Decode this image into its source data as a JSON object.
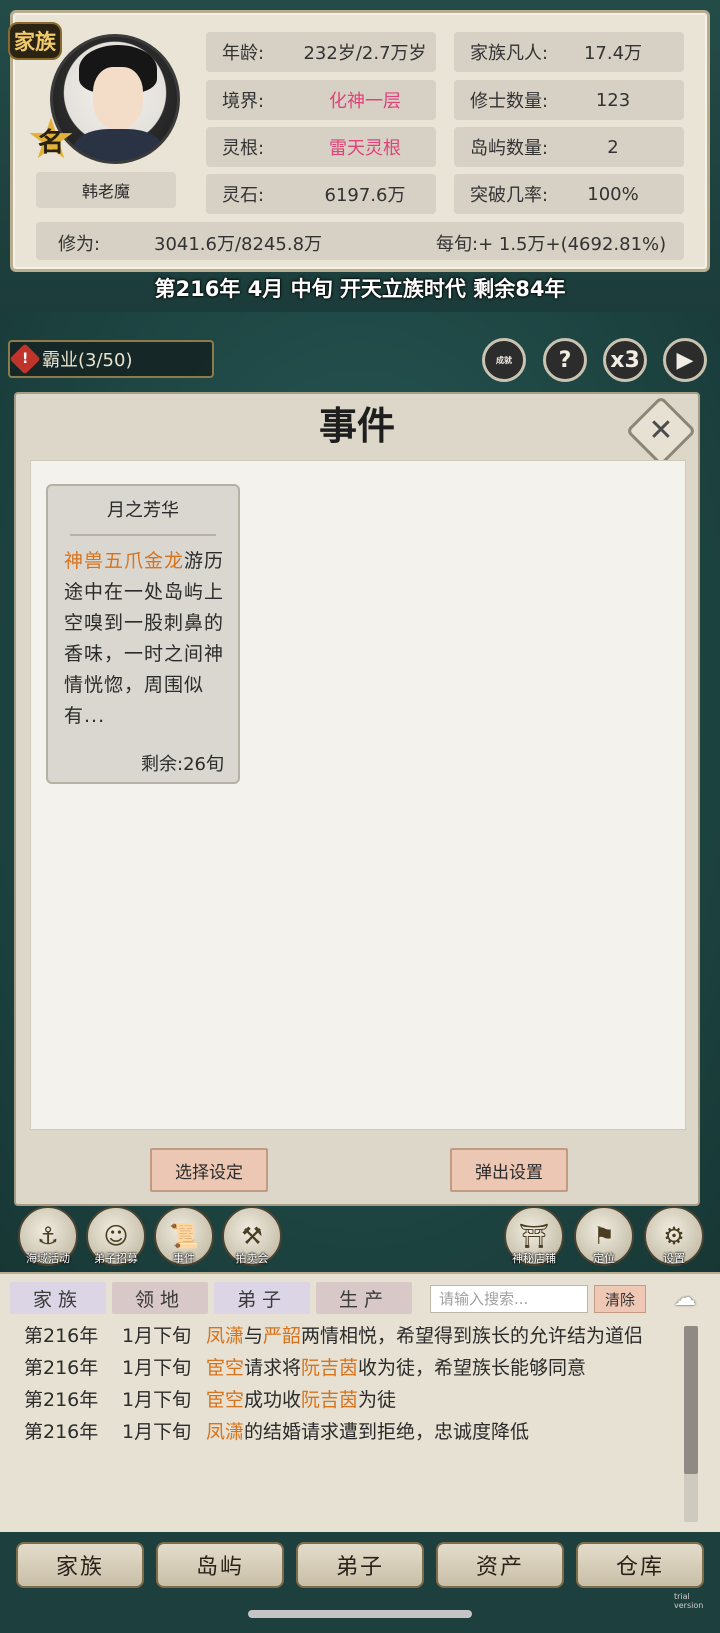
{
  "header": {
    "clan_badge": "家族",
    "star_label": "名",
    "hero_name": "韩老魔",
    "stats": [
      {
        "label": "年龄:",
        "value": "232岁/2.7万岁",
        "highlight": false
      },
      {
        "label": "家族凡人:",
        "value": "17.4万",
        "highlight": false
      },
      {
        "label": "境界:",
        "value": "化神一层",
        "highlight": true
      },
      {
        "label": "修士数量:",
        "value": "123",
        "highlight": false
      },
      {
        "label": "灵根:",
        "value": "雷天灵根",
        "highlight": true
      },
      {
        "label": "岛屿数量:",
        "value": "2",
        "highlight": false
      },
      {
        "label": "灵石:",
        "value": "6197.6万",
        "highlight": false
      },
      {
        "label": "突破几率:",
        "value": "100%",
        "highlight": false
      }
    ],
    "xiuwei_label": "修为:",
    "xiuwei_value": "3041.6万/8245.8万",
    "per_xun": "每旬:+ 1.5万+(4692.81%)",
    "time_line": "第216年 4月  中旬  开天立族时代 剩余84年"
  },
  "toolbar": {
    "hegemony": "霸业(3/50)",
    "achievement": "成就",
    "help": "?",
    "speed": "x3",
    "play": "▶"
  },
  "dialog": {
    "title": "事件",
    "close": "✕",
    "card": {
      "title": "月之芳华",
      "highlight": "神兽五爪金龙",
      "text": "游历途中在一处岛屿上空嗅到一股刺鼻的香味，一时之间神情恍惚，周围似有...",
      "remain": "剩余:26旬"
    },
    "btn_select": "选择设定",
    "btn_popup": "弹出设置"
  },
  "icons": {
    "left": [
      {
        "name": "sea-activity",
        "label": "海域活动"
      },
      {
        "name": "disciple-recruit",
        "label": "弟子招募"
      },
      {
        "name": "event",
        "label": "事件"
      },
      {
        "name": "auction",
        "label": "拍卖会"
      }
    ],
    "right": [
      {
        "name": "mystery-shop",
        "label": "神秘店铺"
      },
      {
        "name": "locate",
        "label": "定位"
      },
      {
        "name": "settings",
        "label": "设置"
      }
    ]
  },
  "tabs": [
    "家族",
    "领地",
    "弟子",
    "生产"
  ],
  "search": {
    "placeholder": "请输入搜索...",
    "clear": "清除"
  },
  "log": [
    {
      "year": "第216年",
      "month": "1月下旬",
      "parts": [
        [
          "n",
          "凤潇"
        ],
        [
          "t",
          "与"
        ],
        [
          "n",
          "严韶"
        ],
        [
          "t",
          "两情相悦，希望得到族长的允许结为道侣"
        ]
      ]
    },
    {
      "year": "第216年",
      "month": "1月下旬",
      "parts": [
        [
          "n",
          "宦空"
        ],
        [
          "t",
          "请求将"
        ],
        [
          "n",
          "阮吉茵"
        ],
        [
          "t",
          "收为徒，希望族长能够同意"
        ]
      ]
    },
    {
      "year": "第216年",
      "month": "1月下旬",
      "parts": [
        [
          "n",
          "宦空"
        ],
        [
          "t",
          "成功收"
        ],
        [
          "n",
          "阮吉茵"
        ],
        [
          "t",
          "为徒"
        ]
      ]
    },
    {
      "year": "第216年",
      "month": "1月下旬",
      "parts": [
        [
          "n",
          "凤潇"
        ],
        [
          "t",
          "的结婚请求遭到拒绝，忠诚度降低"
        ]
      ]
    }
  ],
  "nav": [
    "家族",
    "岛屿",
    "弟子",
    "资产",
    "仓库"
  ],
  "trial_text": "trial version",
  "colors": {
    "accent": "#d8731d",
    "pink": "#e0437a",
    "bg_dark": "#1d3f3d"
  }
}
